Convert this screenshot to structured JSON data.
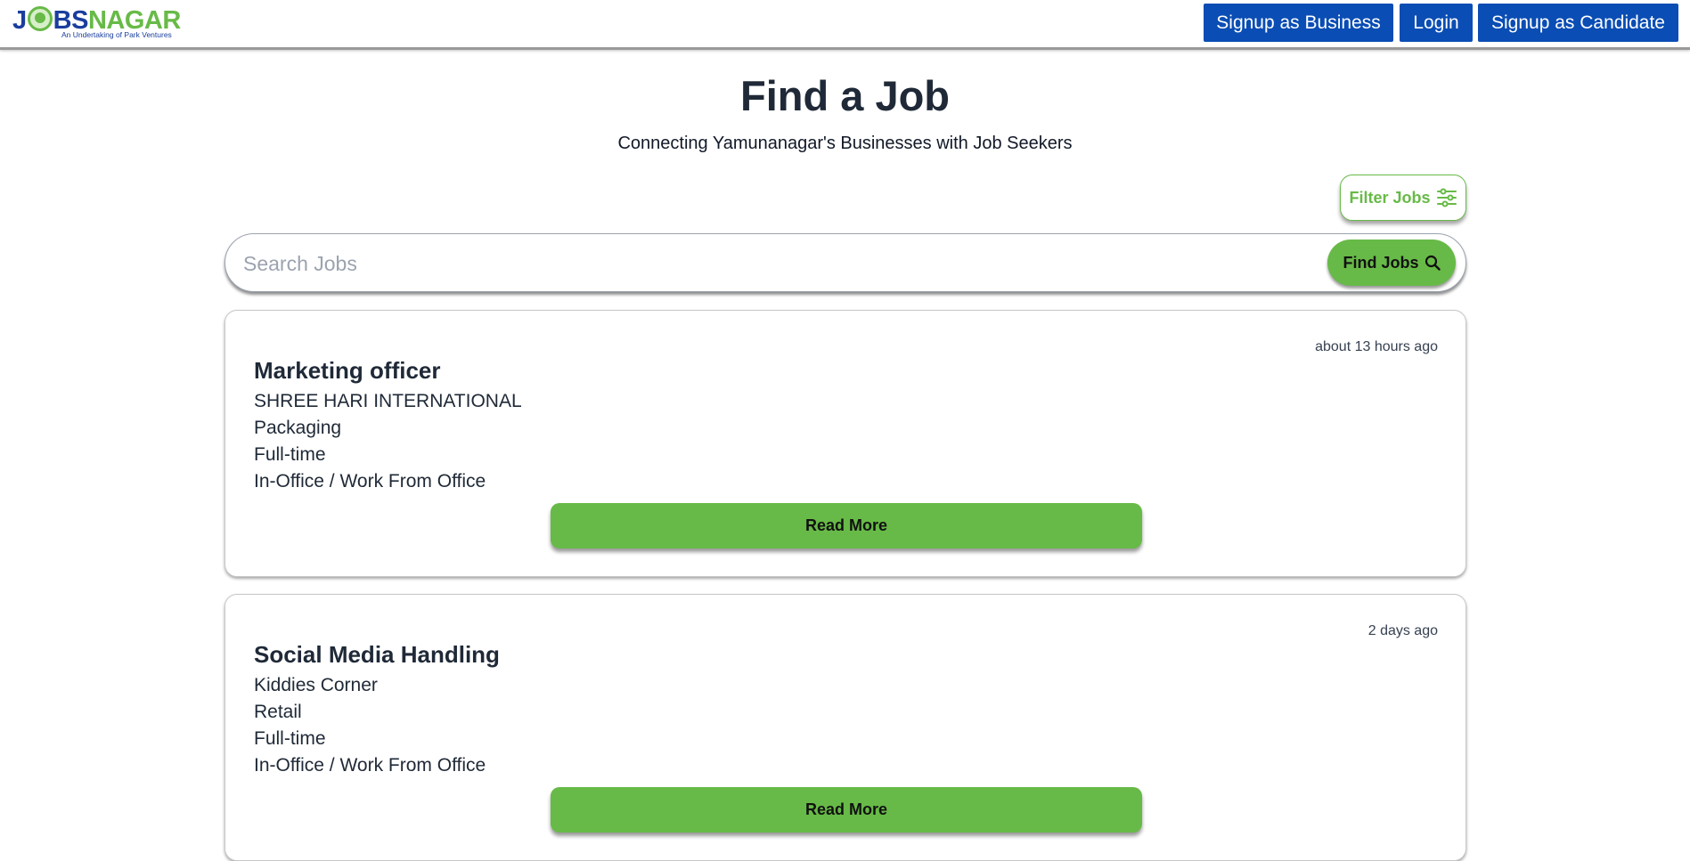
{
  "header": {
    "logo_text_blue_1": "J",
    "logo_text_blue_2": "BS",
    "logo_text_green": "NAGAR",
    "logo_tagline": "An Undertaking of Park Ventures",
    "signup_business_label": "Signup as Business",
    "login_label": "Login",
    "signup_candidate_label": "Signup as Candidate"
  },
  "main": {
    "title": "Find a Job",
    "subtitle": "Connecting Yamunanagar's Businesses with Job Seekers",
    "filter_label": "Filter Jobs",
    "search_placeholder": "Search Jobs",
    "search_value": "",
    "find_label": "Find Jobs"
  },
  "jobs": [
    {
      "time": "about 13 hours ago",
      "title": "Marketing officer",
      "company": "SHREE HARI INTERNATIONAL",
      "category": "Packaging",
      "type": "Full-time",
      "mode": "In-Office / Work From Office",
      "button": "Read More"
    },
    {
      "time": "2 days ago",
      "title": "Social Media Handling",
      "company": "Kiddies Corner",
      "category": "Retail",
      "type": "Full-time",
      "mode": "In-Office / Work From Office",
      "button": "Read More"
    }
  ],
  "colors": {
    "brand_blue": "#0a4db4",
    "brand_green": "#67ba47"
  },
  "icons": {
    "filter": "sliders-icon",
    "search": "search-icon"
  }
}
